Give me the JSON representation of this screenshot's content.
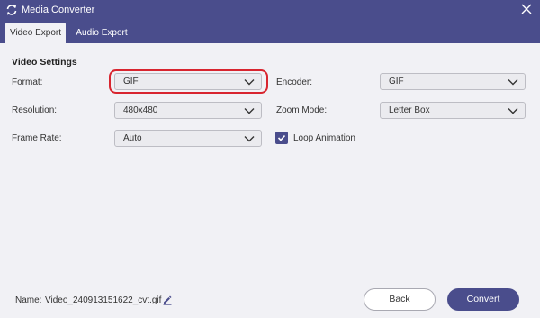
{
  "window": {
    "title": "Media Converter"
  },
  "tabs": [
    {
      "label": "Video Export",
      "active": true
    },
    {
      "label": "Audio Export",
      "active": false
    }
  ],
  "settings": {
    "title": "Video Settings",
    "format": {
      "label": "Format:",
      "value": "GIF"
    },
    "encoder": {
      "label": "Encoder:",
      "value": "GIF"
    },
    "resolution": {
      "label": "Resolution:",
      "value": "480x480"
    },
    "zoom_mode": {
      "label": "Zoom Mode:",
      "value": "Letter Box"
    },
    "frame_rate": {
      "label": "Frame Rate:",
      "value": "Auto"
    },
    "loop_animation": {
      "label": "Loop Animation",
      "checked": true
    }
  },
  "footer": {
    "name_label": "Name:",
    "file_name": "Video_240913151622_cvt.gif",
    "back_label": "Back",
    "convert_label": "Convert"
  },
  "colors": {
    "accent": "#4a4d8c",
    "highlight": "#d8252f",
    "background": "#f1f1f5"
  },
  "icons": {
    "app": "refresh-icon",
    "close": "close-icon",
    "dropdown": "chevron-down-icon",
    "check": "check-icon",
    "edit": "pencil-icon"
  }
}
